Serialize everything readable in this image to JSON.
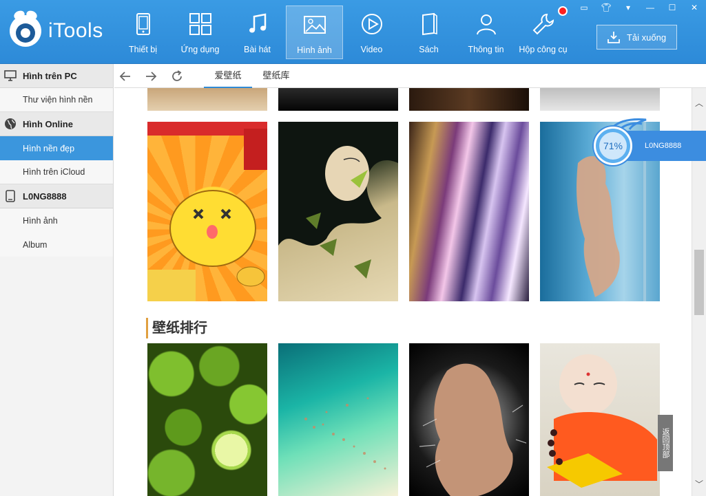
{
  "app": {
    "logo_text": "iTools"
  },
  "nav": [
    {
      "label": "Thiết bị",
      "icon": "phone-icon"
    },
    {
      "label": "Ứng dụng",
      "icon": "apps-grid-icon"
    },
    {
      "label": "Bài hát",
      "icon": "music-note-icon"
    },
    {
      "label": "Hình ảnh",
      "icon": "picture-icon",
      "active": true
    },
    {
      "label": "Video",
      "icon": "play-circle-icon"
    },
    {
      "label": "Sách",
      "icon": "book-icon"
    },
    {
      "label": "Thông tin",
      "icon": "person-icon"
    },
    {
      "label": "Hộp công cụ",
      "icon": "wrench-icon"
    }
  ],
  "download_button": {
    "label": "Tải xuống"
  },
  "sidebar": {
    "sections": [
      {
        "title": "Hình trên PC",
        "icon": "monitor-icon",
        "items": [
          {
            "label": "Thư viện hình nền"
          }
        ]
      },
      {
        "title": "Hình Online",
        "icon": "globe-icon",
        "items": [
          {
            "label": "Hình nền đẹp",
            "active": true
          },
          {
            "label": "Hình trên iCloud"
          }
        ]
      },
      {
        "title": "L0NG8888",
        "icon": "device-icon",
        "items": [
          {
            "label": "Hình ảnh"
          },
          {
            "label": "Album"
          }
        ]
      }
    ]
  },
  "toolbar": {
    "tabs": [
      {
        "label": "爱壁纸",
        "active": true
      },
      {
        "label": "壁纸库"
      }
    ]
  },
  "gallery": {
    "section_title": "壁纸排行"
  },
  "progress": {
    "percent_label": "71%",
    "device_name": "L0NG8888"
  },
  "back_to_top": {
    "label": "返回顶部"
  },
  "colors": {
    "header_blue": "#2d8ad8",
    "active_item": "#3b96dd",
    "tab_underline": "#2f8ad6"
  }
}
